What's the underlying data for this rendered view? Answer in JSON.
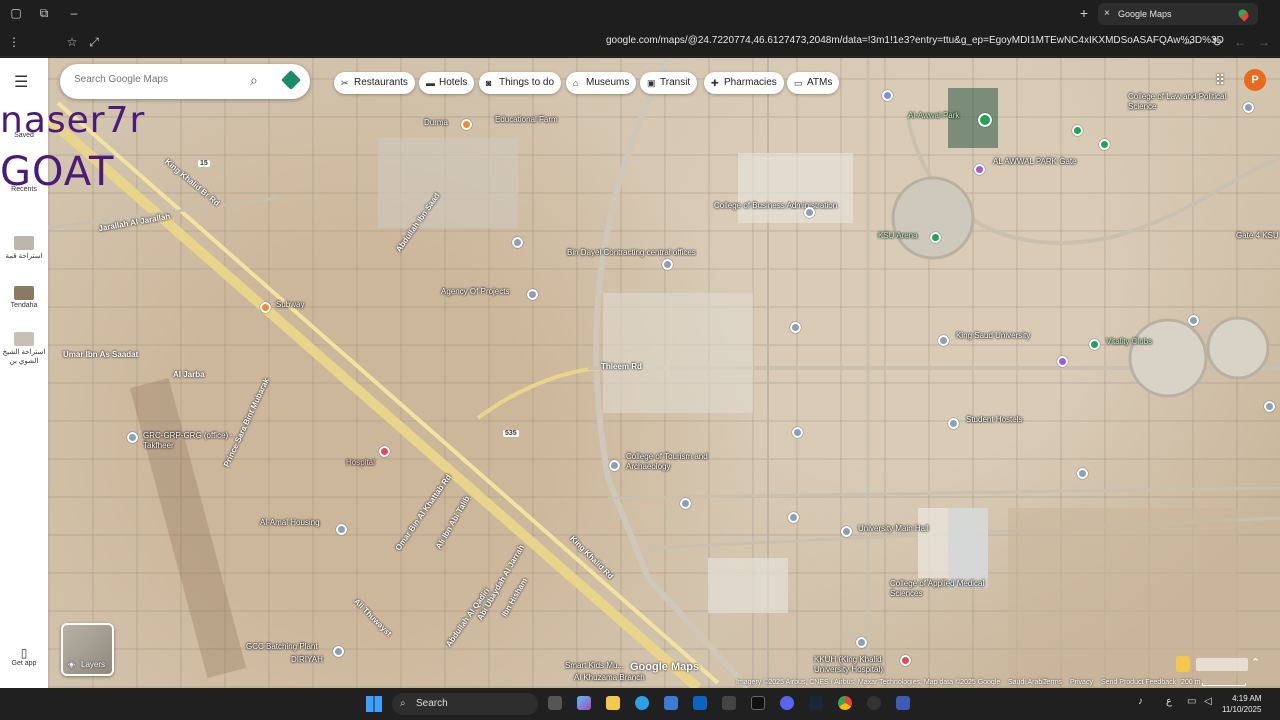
{
  "browser": {
    "tab_title": "Google Maps",
    "url": "google.com/maps/@24.7220774,46.6127473,2048m/data=!3m1!1e3?entry=ttu&g_ep=EgoyMDI1MTEwNC4xIKXMDSoASAFQAw%3D%3D",
    "profile_initial": "P",
    "new_tab": "+",
    "close": "×",
    "window_minimize": "–"
  },
  "maps": {
    "search_placeholder": "Search Google Maps",
    "chips": [
      {
        "label": "Restaurants",
        "icon": "restaurant-icon"
      },
      {
        "label": "Hotels",
        "icon": "hotel-icon"
      },
      {
        "label": "Things to do",
        "icon": "camera-icon"
      },
      {
        "label": "Museums",
        "icon": "museum-icon"
      },
      {
        "label": "Transit",
        "icon": "transit-icon"
      },
      {
        "label": "Pharmacies",
        "icon": "pharmacy-icon"
      },
      {
        "label": "ATMs",
        "icon": "atm-icon"
      }
    ],
    "profile_initial": "P",
    "rail": {
      "saved": "Saved",
      "recents": "Recents",
      "item1": "استراحة قمة",
      "item2": "Tendaha",
      "item3": "استراحة الشيخ الشوي بن",
      "get_app": "Get app"
    },
    "overlay_text": {
      "line1": "naser7r",
      "line2": "GOAT"
    },
    "layers_label": "Layers",
    "places": [
      "Educational Farm",
      "College of Business Administration",
      "Al-Awwal Park",
      "AL AWWAL PARK Gate",
      "Bin Dayel Contracting central offices",
      "Agency Of Projects",
      "KSU Arena",
      "College of Law and Political Science",
      "Gate 4 KSU",
      "Subway",
      "King Saud University",
      "Vitality Clubs",
      "Student Hostels",
      "GRC-GRP-GRG (office) - Takfheer",
      "Hospital",
      "College of Tourism and Archaeology",
      "University Main Hall",
      "Al-Amal Housing",
      "College of Applied Medical Sciences",
      "GCC Batching Plant",
      "DIRIYAH",
      "Smart Kids Mu...",
      "Al Khuzama Branch",
      "KKUH (King Khalid University Hospital)",
      "Durma"
    ],
    "roads": [
      "King Khalid Br Rd",
      "Jarallah Al Jarallah",
      "Abdullah Ibn Saad",
      "Umar Ibn As Saadat",
      "Al Jarba",
      "Thleem Rd",
      "King Khalid Rd",
      "Prince Sara Bint Mubarak",
      "Omar Bin Al Khattab Rd",
      "Ali Ibn Abi Talib",
      "Ibn Hisham",
      "Abi Ubaydah Al Jarrah",
      "Ali Thuwayst",
      "Abdullah Al Qadiri",
      "15",
      "535"
    ],
    "bottom": {
      "google_logo": "Google Maps",
      "attribution": "Imagery ©2025 Airbus, CNES / Airbus, Maxar Technologies, Map data ©2025 Google",
      "links": [
        "Saudi Arabia",
        "Terms",
        "Privacy",
        "Send Product Feedback"
      ],
      "scale": "200 m"
    }
  },
  "taskbar": {
    "search": "Search",
    "time": "4:19 AM",
    "date": "11/10/2025"
  }
}
